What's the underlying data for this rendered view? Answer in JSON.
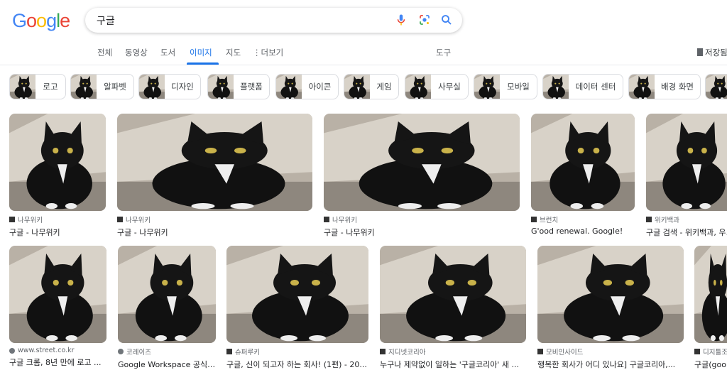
{
  "logo": "Google",
  "search": {
    "query": "구글",
    "icons": [
      "mic-icon",
      "lens-icon",
      "search-icon"
    ]
  },
  "nav": {
    "tabs": [
      {
        "label": "전체"
      },
      {
        "label": "동영상"
      },
      {
        "label": "도서"
      },
      {
        "label": "이미지",
        "active": true
      },
      {
        "label": "지도"
      },
      {
        "label": "더보기"
      }
    ],
    "tools": "도구",
    "saved": "저장됨"
  },
  "chips": [
    "로고",
    "알파벳",
    "디자인",
    "플랫폼",
    "아이콘",
    "게임",
    "사무실",
    "모바일",
    "데이터 센터",
    "배경 화면",
    ""
  ],
  "results_row1": [
    {
      "source": "나무위키",
      "title": "구글 - 나무위키"
    },
    {
      "source": "나무위키",
      "title": "구글 - 나무위키"
    },
    {
      "source": "나무위키",
      "title": "구글 - 나무위키"
    },
    {
      "source": "브런치",
      "title": "G'ood renewal. Google!"
    },
    {
      "source": "위키백과",
      "title": "구글 검색 - 위키백과, 우리 모두의 백과사전"
    }
  ],
  "results_row2": [
    {
      "source": "www.street.co.kr",
      "title": "구글 크롬, 8년 만에 로고 ...",
      "favicon": "globe"
    },
    {
      "source": "코레이즈",
      "title": "Google Workspace 공식 ...",
      "favicon": "globe"
    },
    {
      "source": "슈퍼루키",
      "title": "구글, 신이 되고자 하는 회사! (1편) - 20..."
    },
    {
      "source": "지디넷코리아",
      "title": "누구나 제약없이 일하는 '구글코리아' 새 ..."
    },
    {
      "source": "모비인사이드",
      "title": "행복한 회사가 어디 있나요] 구글코리아,..."
    },
    {
      "source": "디지틀조선",
      "title": "구글(google)..."
    }
  ]
}
